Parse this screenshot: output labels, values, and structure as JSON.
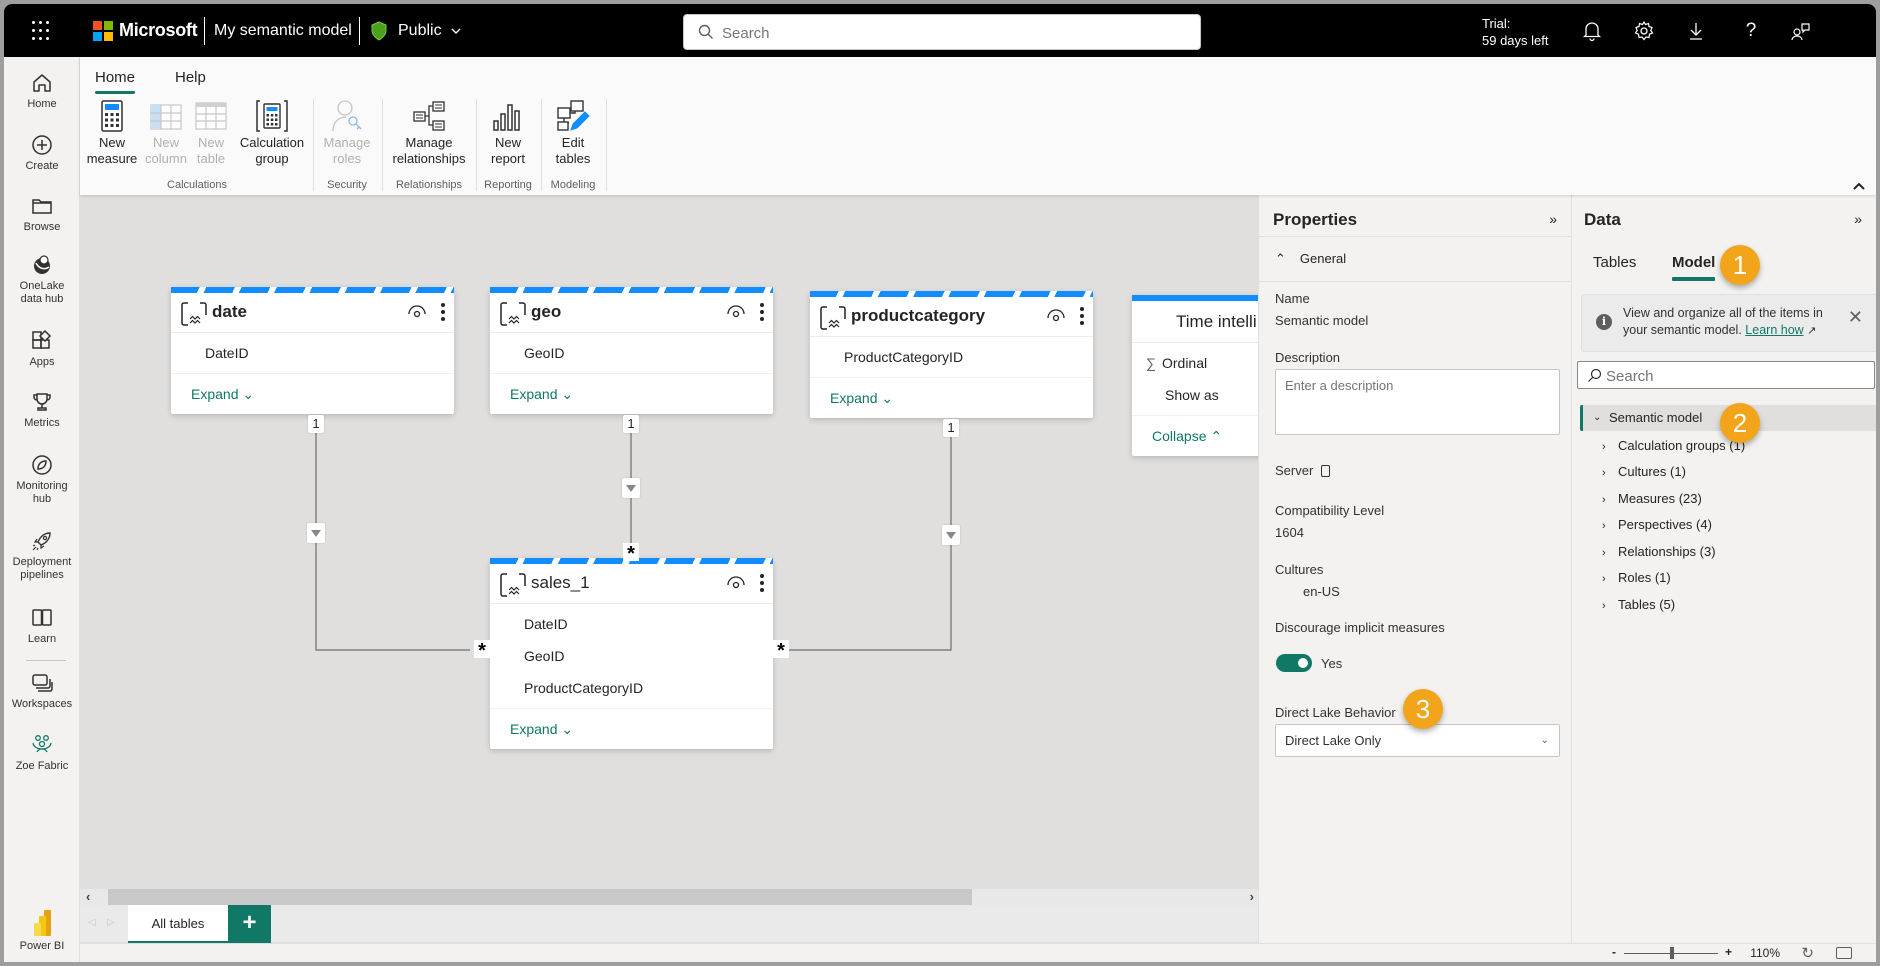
{
  "topbar": {
    "brand": "Microsoft",
    "model_title": "My semantic model",
    "visibility": "Public",
    "search_placeholder": "Search",
    "trial_line1": "Trial:",
    "trial_line2": "59 days left",
    "icons": [
      "bell-icon",
      "gear-icon",
      "download-icon",
      "help-icon",
      "feedback-icon"
    ]
  },
  "leftnav": {
    "items": [
      {
        "label": "Home",
        "icon": "home-icon"
      },
      {
        "label": "Create",
        "icon": "plus-circle-icon"
      },
      {
        "label": "Browse",
        "icon": "folder-icon"
      },
      {
        "label": "OneLake data hub",
        "line1": "OneLake",
        "line2": "data hub",
        "icon": "onelake-icon"
      },
      {
        "label": "Apps",
        "icon": "apps-icon"
      },
      {
        "label": "Metrics",
        "icon": "trophy-icon"
      },
      {
        "label": "Monitoring hub",
        "line1": "Monitoring",
        "line2": "hub",
        "icon": "monitor-icon"
      },
      {
        "label": "Deployment pipelines",
        "line1": "Deployment",
        "line2": "pipelines",
        "icon": "rocket-icon"
      },
      {
        "label": "Learn",
        "icon": "book-icon"
      },
      {
        "label": "Workspaces",
        "icon": "workspaces-icon"
      },
      {
        "label": "Zoe Fabric",
        "icon": "people-icon"
      }
    ],
    "footer_label": "Power BI"
  },
  "ribbon": {
    "tabs": [
      {
        "label": "Home",
        "active": true
      },
      {
        "label": "Help",
        "active": false
      }
    ],
    "buttons": [
      {
        "line1": "New",
        "line2": "measure",
        "enabled": true
      },
      {
        "line1": "New",
        "line2": "column",
        "enabled": false
      },
      {
        "line1": "New",
        "line2": "table",
        "enabled": false
      },
      {
        "line1": "Calculation",
        "line2": "group",
        "enabled": true
      },
      {
        "line1": "Manage",
        "line2": "roles",
        "enabled": false
      },
      {
        "line1": "Manage",
        "line2": "relationships",
        "enabled": true
      },
      {
        "line1": "New",
        "line2": "report",
        "enabled": true
      },
      {
        "line1": "Edit",
        "line2": "tables",
        "enabled": true
      }
    ],
    "groups": [
      "Calculations",
      "Security",
      "Relationships",
      "Reporting",
      "Modeling"
    ]
  },
  "canvas": {
    "tables": [
      {
        "name": "date",
        "fields": [
          "DateID"
        ],
        "action": "Expand"
      },
      {
        "name": "geo",
        "fields": [
          "GeoID"
        ],
        "action": "Expand"
      },
      {
        "name": "productcategory",
        "fields": [
          "ProductCategoryID"
        ],
        "action": "Expand"
      },
      {
        "name": "Time intelli",
        "fields": [
          "Ordinal",
          "Show as"
        ],
        "action": "Collapse"
      },
      {
        "name": "sales_1",
        "fields": [
          "DateID",
          "GeoID",
          "ProductCategoryID"
        ],
        "action": "Expand"
      }
    ],
    "relationships": [
      {
        "from": "date",
        "to": "sales_1",
        "from_card": "1",
        "to_card": "*"
      },
      {
        "from": "geo",
        "to": "sales_1",
        "from_card": "1",
        "to_card": "*"
      },
      {
        "from": "productcategory",
        "to": "sales_1",
        "from_card": "1",
        "to_card": "*"
      }
    ],
    "tab_label": "All tables",
    "add_tab_label": "+"
  },
  "properties": {
    "title": "Properties",
    "section": "General",
    "name_label": "Name",
    "name_value": "Semantic model",
    "description_label": "Description",
    "description_placeholder": "Enter a description",
    "server_label": "Server",
    "compat_label": "Compatibility Level",
    "compat_value": "1604",
    "cultures_label": "Cultures",
    "cultures_value": "en-US",
    "implicit_label": "Discourage implicit measures",
    "implicit_value": "Yes",
    "implicit_on": true,
    "directlake_label": "Direct Lake Behavior",
    "directlake_value": "Direct Lake Only"
  },
  "data_panel": {
    "title": "Data",
    "tabs": [
      {
        "label": "Tables",
        "active": false
      },
      {
        "label": "Model",
        "active": true
      }
    ],
    "info_text": "View and organize all of the items in your semantic model.",
    "info_link": "Learn how",
    "search_placeholder": "Search",
    "tree_root": "Semantic model",
    "tree_items": [
      "Calculation groups (1)",
      "Cultures (1)",
      "Measures (23)",
      "Perspectives (4)",
      "Relationships (3)",
      "Roles (1)",
      "Tables (5)"
    ]
  },
  "status": {
    "zoom": "110%",
    "zoom_fraction": 0.5
  },
  "callouts": [
    "1",
    "2",
    "3"
  ],
  "colors": {
    "accent": "#117865",
    "table_header": "#118dff",
    "callout": "#f2a51b"
  }
}
